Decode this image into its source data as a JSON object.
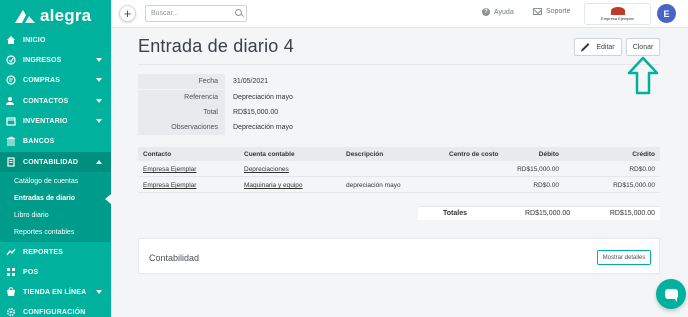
{
  "brand": {
    "name": "alegra",
    "accent": "#00b19d",
    "accent_dark": "#008f7f"
  },
  "sidebar": {
    "items": [
      {
        "label": "INICIO",
        "icon": "home-icon"
      },
      {
        "label": "INGRESOS",
        "icon": "income-icon"
      },
      {
        "label": "COMPRAS",
        "icon": "purchases-icon"
      },
      {
        "label": "CONTACTOS",
        "icon": "contacts-icon"
      },
      {
        "label": "INVENTARIO",
        "icon": "inventory-icon"
      },
      {
        "label": "BANCOS",
        "icon": "bank-icon"
      },
      {
        "label": "CONTABILIDAD",
        "icon": "accounting-icon"
      },
      {
        "label": "REPORTES",
        "icon": "reports-icon"
      },
      {
        "label": "POS",
        "icon": "pos-icon"
      },
      {
        "label": "TIENDA EN LÍNEA",
        "icon": "store-icon"
      },
      {
        "label": "CONFIGURACIÓN",
        "icon": "settings-icon"
      }
    ],
    "submenu": [
      {
        "label": "Catálogo de cuentas"
      },
      {
        "label": "Entradas de diario"
      },
      {
        "label": "Libro diario"
      },
      {
        "label": "Reportes contables"
      }
    ]
  },
  "topbar": {
    "search_placeholder": "Buscar...",
    "help_label": "Ayuda",
    "support_label": "Soporte",
    "company_name": "Empresa Ejemplar",
    "avatar_initial": "E"
  },
  "page": {
    "title": "Entrada de diario 4",
    "edit_label": "Editar",
    "clone_label": "Clonar"
  },
  "info": {
    "rows": [
      {
        "label": "Fecha",
        "value": "31/05/2021"
      },
      {
        "label": "Referencia",
        "value": "Depreciación mayo"
      },
      {
        "label": "Total",
        "value": "RD$15,000.00"
      },
      {
        "label": "Observaciones",
        "value": "Depreciación mayo"
      }
    ]
  },
  "table": {
    "headers": {
      "contact": "Contacto",
      "account": "Cuenta contable",
      "description": "Descripción",
      "cost_center": "Centro de costo",
      "debit": "Débito",
      "credit": "Crédito"
    },
    "rows": [
      {
        "contact": "Empresa Ejemplar",
        "account": "Depreciaciones",
        "description": "",
        "cost_center": "",
        "debit": "RD$15,000.00",
        "credit": "RD$0.00"
      },
      {
        "contact": "Empresa Ejemplar",
        "account": "Maquinaria y equipo",
        "description": "depreciación mayo",
        "cost_center": "",
        "debit": "RD$0.00",
        "credit": "RD$15,000.00"
      }
    ],
    "totals": {
      "label": "Totales",
      "debit": "RD$15,000.00",
      "credit": "RD$15,000.00"
    }
  },
  "card": {
    "title": "Contabilidad",
    "details_label": "Mostrar detalles"
  }
}
